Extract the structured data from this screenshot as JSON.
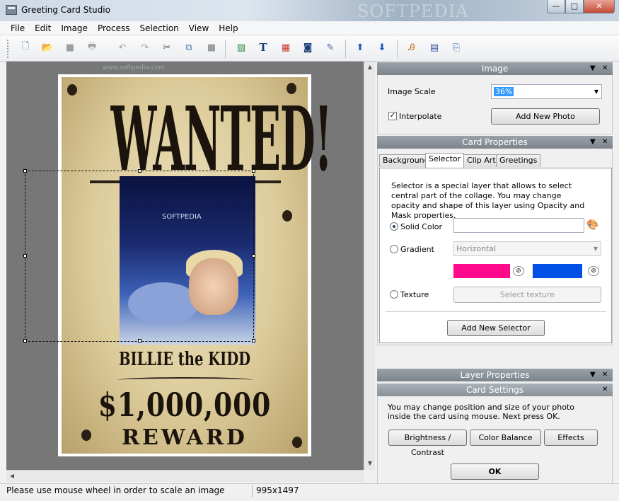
{
  "window": {
    "title": "Greeting Card Studio",
    "watermark": "SOFTPEDIA",
    "min": "—",
    "max": "□",
    "close": "✕"
  },
  "menu": [
    "File",
    "Edit",
    "Image",
    "Process",
    "Selection",
    "View",
    "Help"
  ],
  "toolbar": {
    "buttons": [
      {
        "name": "new-icon",
        "glyph": "🗋"
      },
      {
        "name": "open-folder-icon",
        "glyph": "📂"
      },
      {
        "name": "save-icon",
        "glyph": "■"
      },
      {
        "name": "print-icon",
        "glyph": "🖶"
      },
      {
        "name": "undo-icon",
        "glyph": "↶"
      },
      {
        "name": "redo-icon",
        "glyph": "↷"
      },
      {
        "name": "cut-icon",
        "glyph": "✂"
      },
      {
        "name": "copy-icon",
        "glyph": "⧉"
      },
      {
        "name": "paste-icon",
        "glyph": "■"
      },
      {
        "name": "add-image-icon",
        "glyph": "▨"
      },
      {
        "name": "text-icon",
        "glyph": "T"
      },
      {
        "name": "clipart-icon",
        "glyph": "▦"
      },
      {
        "name": "frame-icon",
        "glyph": "◙"
      },
      {
        "name": "effects-wand-icon",
        "glyph": "✎"
      },
      {
        "name": "move-up-icon",
        "glyph": "⬆"
      },
      {
        "name": "move-down-icon",
        "glyph": "⬇"
      },
      {
        "name": "font-icon",
        "glyph": "Ꭿ"
      },
      {
        "name": "page-icon",
        "glyph": "▤"
      },
      {
        "name": "export-icon",
        "glyph": "⎘"
      }
    ]
  },
  "canvas": {
    "watermark": "www.softpedia.com",
    "poster": {
      "headline": "WANTED!",
      "name": "BILLIE the KIDD",
      "amount": "$1,000,000",
      "reward": "REWARD",
      "photo_watermark": "SOFTPEDIA"
    }
  },
  "image_panel": {
    "title": "Image",
    "scale_label": "Image Scale",
    "scale_value": "36%",
    "interpolate_label": "Interpolate",
    "interpolate_checked": true,
    "add_photo": "Add New Photo"
  },
  "card_props": {
    "title": "Card Properties",
    "tabs": [
      "Background",
      "Selector",
      "Clip Art",
      "Greetings"
    ],
    "active_tab": "Selector",
    "description": "Selector is a special layer that allows to select central part of the collage. You may change opacity and shape of this layer using Opacity and Mask properties.",
    "solid_color": "Solid Color",
    "gradient": "Gradient",
    "gradient_value": "Horizontal",
    "gradient_color1": "#ff0a8c",
    "gradient_color2": "#0050e6",
    "texture": "Texture",
    "select_texture": "Select texture",
    "add_selector": "Add New Selector"
  },
  "layer_props": {
    "title": "Layer Properties"
  },
  "card_settings": {
    "title": "Card Settings",
    "text": "You may change position and size of your photo inside the card using mouse. Next press OK.",
    "brightness": "Brightness / Contrast",
    "color_balance": "Color Balance",
    "effects": "Effects",
    "ok": "OK"
  },
  "status": {
    "hint": "Please use mouse wheel in order to scale an image",
    "size": "995x1497"
  }
}
